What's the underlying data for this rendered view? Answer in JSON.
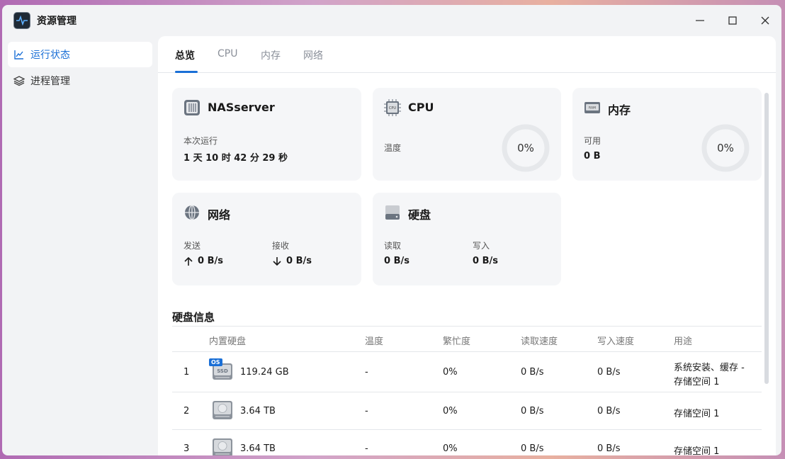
{
  "app": {
    "title": "资源管理",
    "icon": "activity-icon"
  },
  "window_controls": [
    "minimize-icon",
    "maximize-icon",
    "close-icon"
  ],
  "sidebar": {
    "items": [
      {
        "label": "运行状态",
        "icon": "line-chart-icon",
        "active": true
      },
      {
        "label": "进程管理",
        "icon": "layers-icon",
        "active": false
      }
    ]
  },
  "tabs": [
    "总览",
    "CPU",
    "内存",
    "网络"
  ],
  "cards": {
    "server": {
      "title": "NASserver",
      "uptime_label": "本次运行",
      "uptime_value": "1 天 10 时 42 分 29 秒"
    },
    "cpu": {
      "title": "CPU",
      "temp_label": "温度",
      "usage": "0%",
      "chip_text": "CPU"
    },
    "memory": {
      "title": "内存",
      "avail_label": "可用",
      "avail_value": "0 B",
      "usage": "0%",
      "chip_text": "RAM"
    },
    "network": {
      "title": "网络",
      "send_label": "发送",
      "send_value": "0 B/s",
      "recv_label": "接收",
      "recv_value": "0 B/s"
    },
    "disk": {
      "title": "硬盘",
      "read_label": "读取",
      "read_value": "0 B/s",
      "write_label": "写入",
      "write_value": "0 B/s"
    }
  },
  "disk_info": {
    "title": "硬盘信息",
    "columns": [
      "内置硬盘",
      "温度",
      "繁忙度",
      "读取速度",
      "写入速度",
      "用途"
    ],
    "rows": [
      {
        "index": "1",
        "type": "SSD",
        "badge": "OS",
        "capacity": "119.24 GB",
        "temp": "-",
        "busy": "0%",
        "read": "0 B/s",
        "write": "0 B/s",
        "usage_line1": "系统安装、缓存 -",
        "usage_line2": "存储空间 1"
      },
      {
        "index": "2",
        "type": "HDD",
        "capacity": "3.64 TB",
        "temp": "-",
        "busy": "0%",
        "read": "0 B/s",
        "write": "0 B/s",
        "usage_line1": "存储空间 1"
      },
      {
        "index": "3",
        "type": "HDD",
        "capacity": "3.64 TB",
        "temp": "-",
        "busy": "0%",
        "read": "0 B/s",
        "write": "0 B/s",
        "usage_line1": "存储空间 1"
      }
    ]
  },
  "colors": {
    "accent": "#1a6fd6",
    "card_bg": "#f5f6f8",
    "window_bg": "#f2f3f5"
  }
}
